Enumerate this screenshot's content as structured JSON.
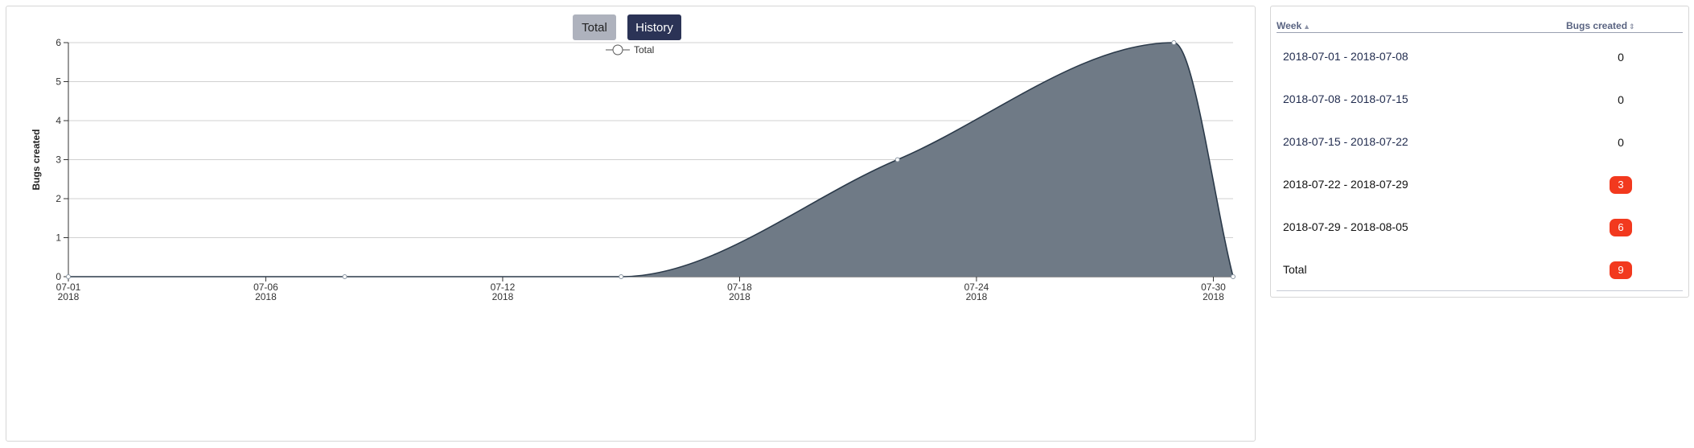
{
  "buttons": {
    "total_label": "Total",
    "history_label": "History"
  },
  "chart_data": {
    "type": "area",
    "legend": {
      "name": "Total",
      "position": "top"
    },
    "ylabel": "Bugs created",
    "ylim": [
      0,
      6
    ],
    "yticks": [
      0,
      1,
      2,
      3,
      4,
      5,
      6
    ],
    "xlim": [
      "2018-07-01",
      "2018-07-30 12:00"
    ],
    "xticks": [
      {
        "date": "2018-07-01",
        "label": "07-01",
        "sublabel": "2018"
      },
      {
        "date": "2018-07-06",
        "label": "07-06",
        "sublabel": "2018"
      },
      {
        "date": "2018-07-12",
        "label": "07-12",
        "sublabel": "2018"
      },
      {
        "date": "2018-07-18",
        "label": "07-18",
        "sublabel": "2018"
      },
      {
        "date": "2018-07-24",
        "label": "07-24",
        "sublabel": "2018"
      },
      {
        "date": "2018-07-30",
        "label": "07-30",
        "sublabel": "2018"
      }
    ],
    "series": [
      {
        "name": "Total",
        "x": [
          "2018-07-01",
          "2018-07-08",
          "2018-07-15",
          "2018-07-22",
          "2018-07-29",
          "2018-07-30 12:00"
        ],
        "y": [
          0,
          0,
          0,
          3,
          6,
          0
        ]
      }
    ],
    "colors": {
      "fill": "#6f7a86",
      "stroke": "#2b3a4a",
      "grid": "#d0d0d0"
    }
  },
  "table": {
    "headers": {
      "week": "Week",
      "bugs": "Bugs created"
    },
    "rows": [
      {
        "week": "2018-07-01 - 2018-07-08",
        "value": "0",
        "badge": false
      },
      {
        "week": "2018-07-08 - 2018-07-15",
        "value": "0",
        "badge": false
      },
      {
        "week": "2018-07-15 - 2018-07-22",
        "value": "0",
        "badge": false
      },
      {
        "week": "2018-07-22 - 2018-07-29",
        "value": "3",
        "badge": true
      },
      {
        "week": "2018-07-29 - 2018-08-05",
        "value": "6",
        "badge": true
      },
      {
        "week": "Total",
        "value": "9",
        "badge": true
      }
    ],
    "badge_color": "#f2391e"
  }
}
